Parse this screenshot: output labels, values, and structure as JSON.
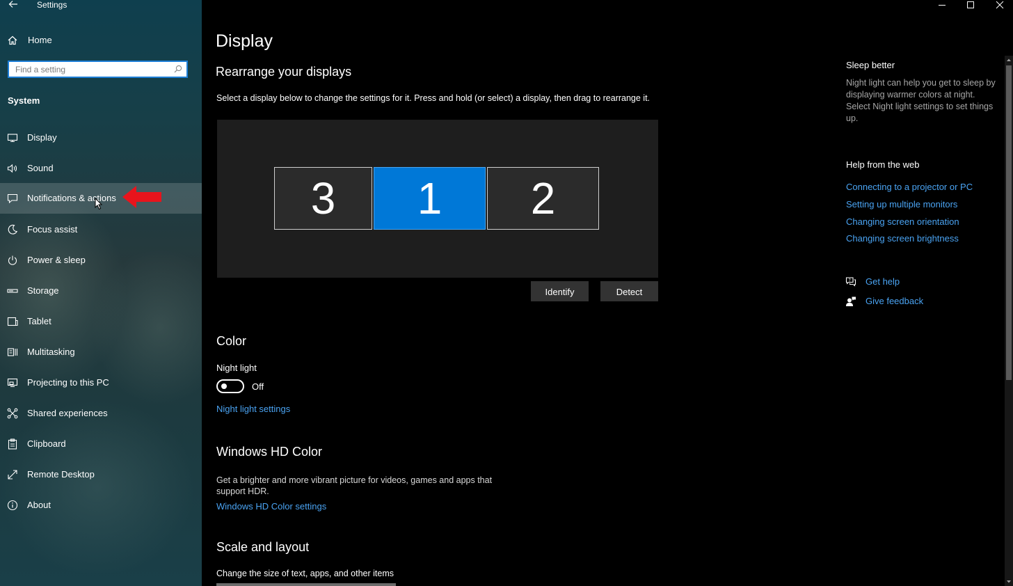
{
  "window": {
    "title": "Settings"
  },
  "sidebar": {
    "home_label": "Home",
    "search_placeholder": "Find a setting",
    "section_heading": "System",
    "items": [
      {
        "label": "Display",
        "icon": "monitor-icon"
      },
      {
        "label": "Sound",
        "icon": "speaker-icon"
      },
      {
        "label": "Notifications & actions",
        "icon": "notification-icon"
      },
      {
        "label": "Focus assist",
        "icon": "moon-icon"
      },
      {
        "label": "Power & sleep",
        "icon": "power-icon"
      },
      {
        "label": "Storage",
        "icon": "storage-icon"
      },
      {
        "label": "Tablet",
        "icon": "tablet-icon"
      },
      {
        "label": "Multitasking",
        "icon": "multitasking-icon"
      },
      {
        "label": "Projecting to this PC",
        "icon": "projecting-icon"
      },
      {
        "label": "Shared experiences",
        "icon": "shared-icon"
      },
      {
        "label": "Clipboard",
        "icon": "clipboard-icon"
      },
      {
        "label": "Remote Desktop",
        "icon": "remote-desktop-icon"
      },
      {
        "label": "About",
        "icon": "info-icon"
      }
    ],
    "hovered_item": "Notifications & actions"
  },
  "main": {
    "title": "Display",
    "rearrange": {
      "heading": "Rearrange your displays",
      "description": "Select a display below to change the settings for it. Press and hold (or select) a display, then drag to rearrange it.",
      "monitors": [
        {
          "number": "3",
          "selected": false
        },
        {
          "number": "1",
          "selected": true
        },
        {
          "number": "2",
          "selected": false
        }
      ],
      "identify_label": "Identify",
      "detect_label": "Detect"
    },
    "color": {
      "heading": "Color",
      "night_light_label": "Night light",
      "night_light_state": "Off",
      "night_light_settings_link": "Night light settings"
    },
    "hd_color": {
      "heading": "Windows HD Color",
      "description": "Get a brighter and more vibrant picture for videos, games and apps that support HDR.",
      "settings_link": "Windows HD Color settings"
    },
    "scale": {
      "heading": "Scale and layout",
      "description": "Change the size of text, apps, and other items"
    }
  },
  "right_panel": {
    "sleep_heading": "Sleep better",
    "sleep_description": "Night light can help you get to sleep by displaying warmer colors at night. Select Night light settings to set things up.",
    "help_heading": "Help from the web",
    "help_links": [
      "Connecting to a projector or PC",
      "Setting up multiple monitors",
      "Changing screen orientation",
      "Changing screen brightness"
    ],
    "get_help": "Get help",
    "give_feedback": "Give feedback"
  },
  "colors": {
    "accent": "#0078d7",
    "link": "#4aa3f2",
    "annotation_arrow": "#e8141c"
  }
}
